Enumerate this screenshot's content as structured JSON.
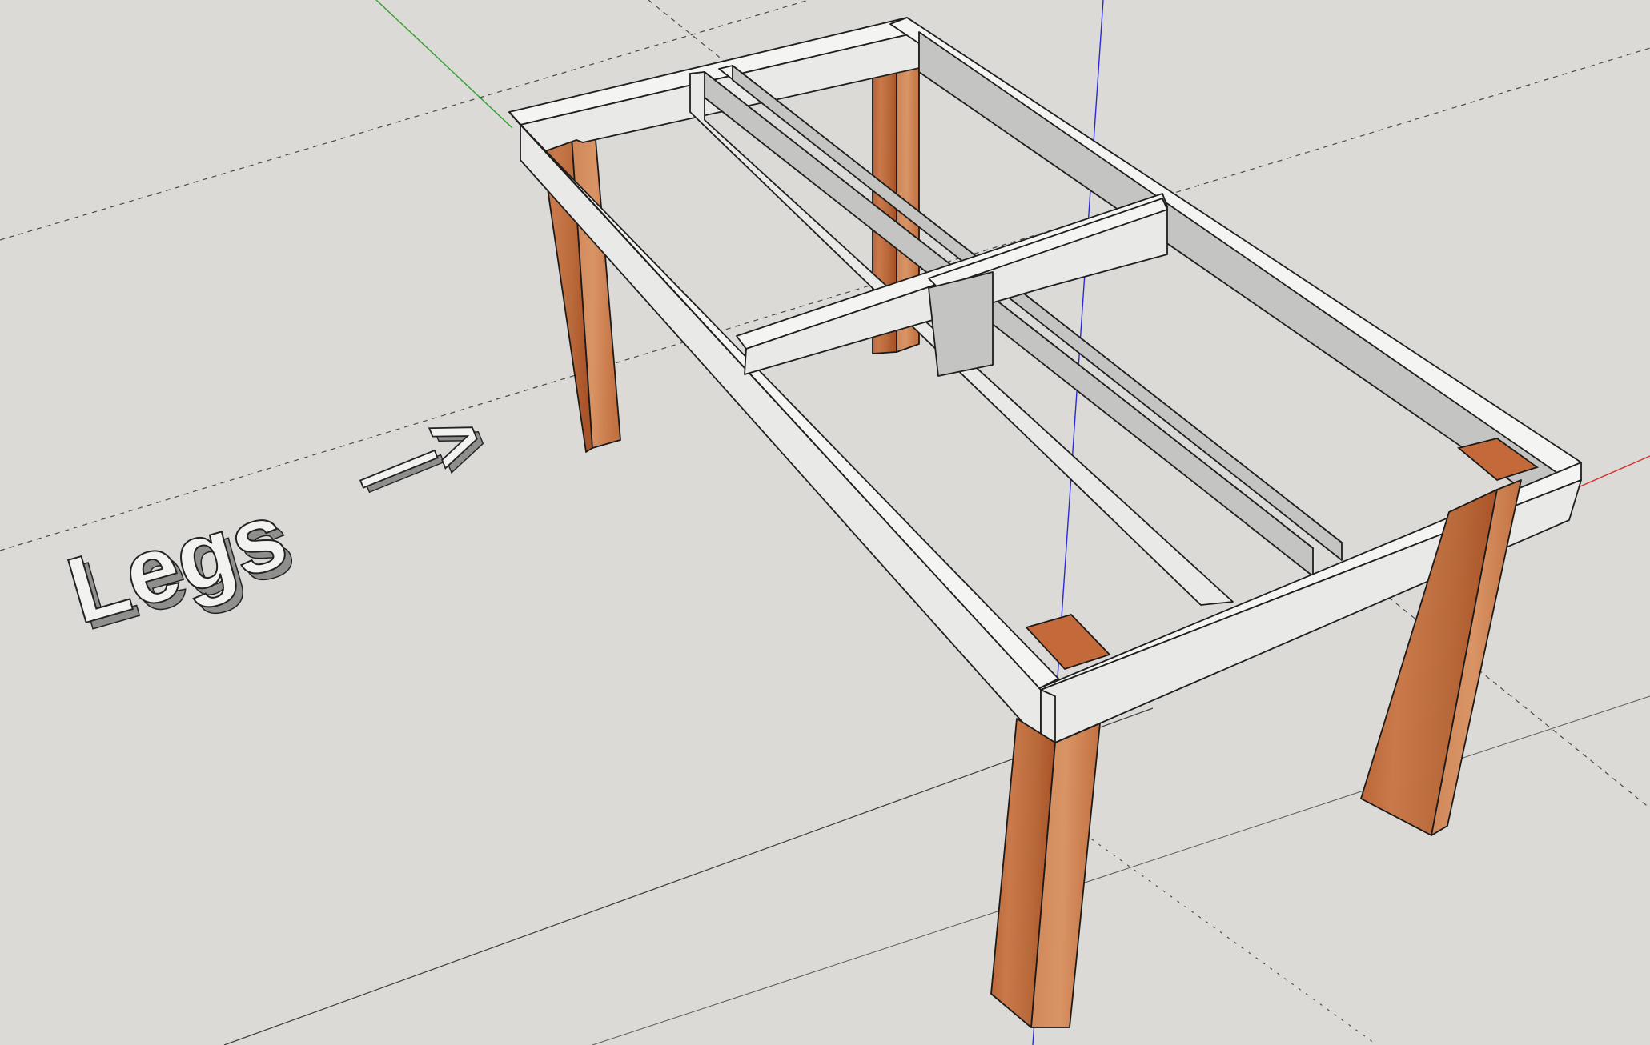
{
  "scene": {
    "label_text": "Legs",
    "arrow_text": "—>",
    "colors": {
      "background": "#dbdad6",
      "frame_top": "#f4f4f3",
      "frame_side": "#c4c4c3",
      "wood_light": "#c97a48",
      "wood_dark": "#a8532a",
      "axis_red": "#d83030",
      "axis_green": "#30a030",
      "axis_blue": "#2a2ad8"
    },
    "objects": [
      "table-frame",
      "table-leg-back-left",
      "table-leg-back-right",
      "table-leg-front-left",
      "table-leg-front-right",
      "legs-3d-text",
      "arrow-3d-text"
    ]
  }
}
